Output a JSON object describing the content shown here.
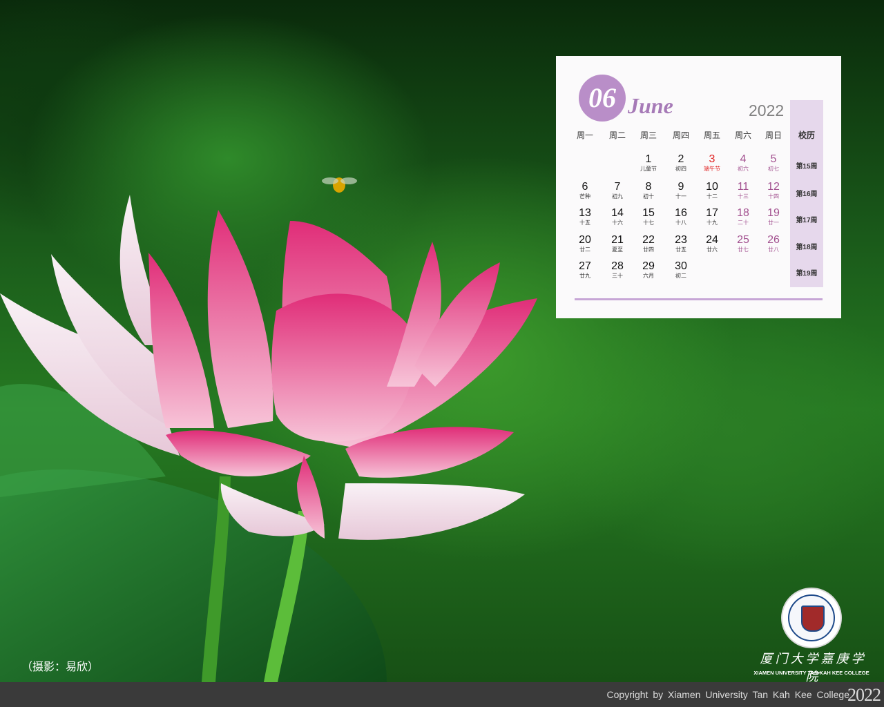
{
  "calendar": {
    "month_number": "06",
    "month_name": "June",
    "year": "2022",
    "weekdays": [
      "周一",
      "周二",
      "周三",
      "周四",
      "周五",
      "周六",
      "周日"
    ],
    "school_label": "校历",
    "weeks": [
      {
        "label": "第15周",
        "days": [
          {
            "col": 2,
            "num": "1",
            "lunar": "儿童节"
          },
          {
            "col": 3,
            "num": "2",
            "lunar": "初四"
          },
          {
            "col": 4,
            "num": "3",
            "lunar": "端午节",
            "holiday": true
          },
          {
            "col": 5,
            "num": "4",
            "lunar": "初六"
          },
          {
            "col": 6,
            "num": "5",
            "lunar": "初七"
          }
        ]
      },
      {
        "label": "第16周",
        "days": [
          {
            "col": 0,
            "num": "6",
            "lunar": "芒种"
          },
          {
            "col": 1,
            "num": "7",
            "lunar": "初九"
          },
          {
            "col": 2,
            "num": "8",
            "lunar": "初十"
          },
          {
            "col": 3,
            "num": "9",
            "lunar": "十一"
          },
          {
            "col": 4,
            "num": "10",
            "lunar": "十二"
          },
          {
            "col": 5,
            "num": "11",
            "lunar": "十三"
          },
          {
            "col": 6,
            "num": "12",
            "lunar": "十四"
          }
        ]
      },
      {
        "label": "第17周",
        "days": [
          {
            "col": 0,
            "num": "13",
            "lunar": "十五"
          },
          {
            "col": 1,
            "num": "14",
            "lunar": "十六"
          },
          {
            "col": 2,
            "num": "15",
            "lunar": "十七"
          },
          {
            "col": 3,
            "num": "16",
            "lunar": "十八"
          },
          {
            "col": 4,
            "num": "17",
            "lunar": "十九"
          },
          {
            "col": 5,
            "num": "18",
            "lunar": "二十"
          },
          {
            "col": 6,
            "num": "19",
            "lunar": "廿一"
          }
        ]
      },
      {
        "label": "第18周",
        "days": [
          {
            "col": 0,
            "num": "20",
            "lunar": "廿二"
          },
          {
            "col": 1,
            "num": "21",
            "lunar": "夏至"
          },
          {
            "col": 2,
            "num": "22",
            "lunar": "廿四"
          },
          {
            "col": 3,
            "num": "23",
            "lunar": "廿五"
          },
          {
            "col": 4,
            "num": "24",
            "lunar": "廿六"
          },
          {
            "col": 5,
            "num": "25",
            "lunar": "廿七"
          },
          {
            "col": 6,
            "num": "26",
            "lunar": "廿八"
          }
        ]
      },
      {
        "label": "第19周",
        "days": [
          {
            "col": 0,
            "num": "27",
            "lunar": "廿九"
          },
          {
            "col": 1,
            "num": "28",
            "lunar": "三十"
          },
          {
            "col": 2,
            "num": "29",
            "lunar": "六月"
          },
          {
            "col": 3,
            "num": "30",
            "lunar": "初二"
          }
        ]
      }
    ]
  },
  "photo_credit": "（摄影：易欣）",
  "school": {
    "name_cn": "厦门大学嘉庚学院",
    "name_en": "XIAMEN UNIVERSITY TAN KAH KEE COLLEGE"
  },
  "footer": {
    "copyright": "Copyright by Xiamen University Tan Kah Kee College",
    "year": "2022"
  },
  "colors": {
    "accent_purple": "#b98ec8",
    "weekend": "#a2508f",
    "holiday": "#e02020",
    "footer_bg": "#3a3a3a"
  }
}
